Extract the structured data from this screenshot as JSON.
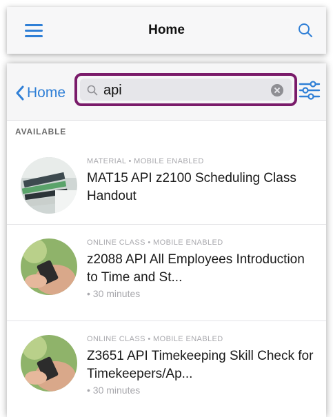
{
  "header": {
    "title": "Home",
    "menu_icon": "hamburger-menu-icon",
    "search_icon": "search-icon",
    "accent_color": "#2f7fd6"
  },
  "search": {
    "back_label": "Home",
    "query": "api",
    "highlight_color": "#7a1b6a",
    "filter_icon": "sliders-filter-icon"
  },
  "section": {
    "title": "AVAILABLE"
  },
  "results": [
    {
      "meta": "MATERIAL • MOBILE ENABLED",
      "title": "MAT15 API z2100 Scheduling Class Handout",
      "duration": ""
    },
    {
      "meta": "ONLINE CLASS • MOBILE ENABLED",
      "title": "z2088 API All Employees Introduction to Time and St...",
      "duration": "• 30 minutes"
    },
    {
      "meta": "ONLINE CLASS • MOBILE ENABLED",
      "title": "Z3651 API Timekeeping Skill Check for Timekeepers/Ap...",
      "duration": "• 30 minutes"
    }
  ]
}
